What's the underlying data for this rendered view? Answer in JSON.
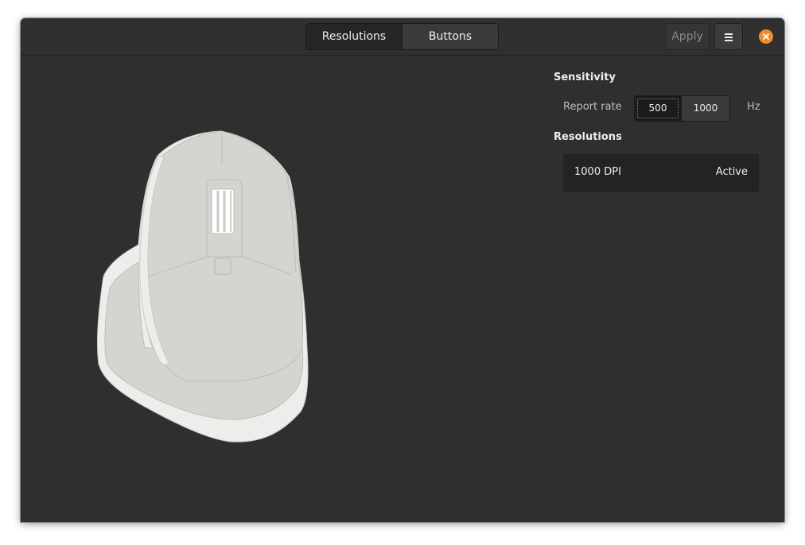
{
  "header": {
    "tabs": [
      {
        "label": "Resolutions",
        "active": true
      },
      {
        "label": "Buttons",
        "active": false
      }
    ],
    "apply_label": "Apply",
    "menu_icon": "hamburger-menu-icon",
    "close_icon": "close-icon"
  },
  "colors": {
    "window_bg": "#2f2f2f",
    "accent_close": "#f08a2c",
    "mouse_body": "#d4d4d0",
    "mouse_outline": "#ededeb"
  },
  "sensitivity": {
    "title": "Sensitivity",
    "report_rate_label": "Report rate",
    "rates": [
      {
        "label": "500",
        "selected": true
      },
      {
        "label": "1000",
        "selected": false
      }
    ],
    "unit": "Hz"
  },
  "resolutions": {
    "title": "Resolutions",
    "items": [
      {
        "dpi": "1000 DPI",
        "status": "Active"
      }
    ]
  }
}
